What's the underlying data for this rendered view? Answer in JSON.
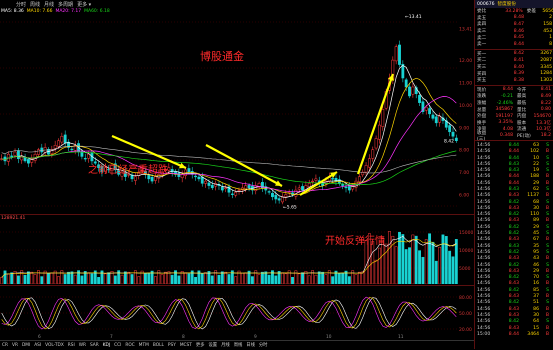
{
  "toolbar": {
    "items": [
      "分时",
      "周线",
      "月线",
      "多周期",
      "更多 ▾"
    ]
  },
  "ma_legend": [
    {
      "label": "MA5",
      "value": "8.36",
      "color": "#ffffff"
    },
    {
      "label": "MA10",
      "value": "7.66",
      "color": "#ffd700"
    },
    {
      "label": "MA20",
      "value": "7.17",
      "color": "#ff33ff"
    },
    {
      "label": "MA60",
      "value": "6.18",
      "color": "#19d319"
    }
  ],
  "price_axis": [
    "13.41",
    "12.00",
    "11.00",
    "10.00",
    "9.00",
    "8.00",
    "7.00",
    "6.00",
    "5.00"
  ],
  "price_markers": {
    "high": "13.41",
    "low": "5.65",
    "current_tag": "8.42"
  },
  "volume_label": "128921.41",
  "volume_axis": [
    "15000",
    "10000",
    "5000"
  ],
  "annotations": {
    "title": "博股通金",
    "note_down": "之前已经严重超跌",
    "note_up": "开始反弹行情"
  },
  "bottom_tabs": [
    "CR",
    "VR",
    "DMI",
    "ASI",
    "VOL-TDX",
    "RSI",
    "WR",
    "SAR",
    "KDJ",
    "CCI",
    "ROC",
    "MTM",
    "BOLL",
    "PSY",
    "MCST",
    "更多",
    "设置",
    "月线",
    "周线",
    "日线",
    "分时"
  ],
  "bottom_active": "KDJ",
  "x_ticks": [
    "6",
    "7",
    "8",
    "9",
    "10",
    "11"
  ],
  "stock": {
    "code": "000676",
    "name": "智度股份"
  },
  "orderbook_header": {
    "label": "委比",
    "value": "33.28%",
    "label2": "委差",
    "value2": "5656"
  },
  "asks": [
    {
      "label": "卖五",
      "price": "8.48",
      "vol": "2"
    },
    {
      "label": "卖四",
      "price": "8.47",
      "vol": "158"
    },
    {
      "label": "卖三",
      "price": "8.46",
      "vol": "453"
    },
    {
      "label": "卖二",
      "price": "8.45",
      "vol": "1"
    },
    {
      "label": "卖一",
      "price": "8.44",
      "vol": "8"
    }
  ],
  "bids": [
    {
      "label": "买一",
      "price": "8.42",
      "vol": "3267"
    },
    {
      "label": "买二",
      "price": "8.41",
      "vol": "2087"
    },
    {
      "label": "买三",
      "price": "8.40",
      "vol": "3345"
    },
    {
      "label": "买四",
      "price": "8.39",
      "vol": "1284"
    },
    {
      "label": "买五",
      "price": "8.38",
      "vol": "1303"
    }
  ],
  "stats": [
    {
      "k": "现价",
      "v": "8.44",
      "k2": "今开",
      "v2": "8.41"
    },
    {
      "k": "涨跌",
      "v": "-0.21",
      "k2": "最高",
      "v2": "8.49"
    },
    {
      "k": "涨幅",
      "v": "-2.46%",
      "k2": "最低",
      "v2": "8.22"
    },
    {
      "k": "总量",
      "v": "345867",
      "k2": "量比",
      "v2": "0.80"
    },
    {
      "k": "外盘",
      "v": "191197",
      "k2": "内盘",
      "v2": "154670"
    },
    {
      "k": "换手",
      "v": "3.35%",
      "k2": "股本",
      "v2": "13.3亿"
    },
    {
      "k": "净资",
      "v": "4.08",
      "k2": "流通",
      "v2": "10.3亿"
    },
    {
      "k": "收益(三)",
      "v": "0.348",
      "k2": "PE(动)",
      "v2": "18.2"
    }
  ],
  "ticks": [
    {
      "t": "14:56",
      "p": "8.44",
      "v": "63",
      "d": "S"
    },
    {
      "t": "14:56",
      "p": "8.44",
      "v": "102",
      "d": "B"
    },
    {
      "t": "14:56",
      "p": "8.44",
      "v": "10",
      "d": "S"
    },
    {
      "t": "14:56",
      "p": "8.43",
      "v": "22",
      "d": "S"
    },
    {
      "t": "14:56",
      "p": "8.43",
      "v": "19",
      "d": "S"
    },
    {
      "t": "14:56",
      "p": "8.44",
      "v": "188",
      "d": "B"
    },
    {
      "t": "14:56",
      "p": "8.44",
      "v": "29",
      "d": "B"
    },
    {
      "t": "14:56",
      "p": "8.43",
      "v": "62",
      "d": "S"
    },
    {
      "t": "14:56",
      "p": "8.43",
      "v": "1137",
      "d": "B"
    },
    {
      "t": "14:56",
      "p": "8.42",
      "v": "68",
      "d": "S"
    },
    {
      "t": "14:56",
      "p": "8.43",
      "v": "30",
      "d": "B"
    },
    {
      "t": "14:56",
      "p": "8.42",
      "v": "110",
      "d": "S"
    },
    {
      "t": "14:56",
      "p": "8.43",
      "v": "89",
      "d": "B"
    },
    {
      "t": "14:56",
      "p": "8.42",
      "v": "29",
      "d": "S"
    },
    {
      "t": "14:56",
      "p": "8.42",
      "v": "45",
      "d": "S"
    },
    {
      "t": "14:56",
      "p": "8.43",
      "v": "67",
      "d": "B"
    },
    {
      "t": "14:56",
      "p": "8.43",
      "v": "35",
      "d": "S"
    },
    {
      "t": "14:56",
      "p": "8.42",
      "v": "95",
      "d": "S"
    },
    {
      "t": "14:56",
      "p": "8.43",
      "v": "43",
      "d": "B"
    },
    {
      "t": "14:56",
      "p": "8.42",
      "v": "46",
      "d": "S"
    },
    {
      "t": "14:56",
      "p": "8.43",
      "v": "29",
      "d": "B"
    },
    {
      "t": "14:56",
      "p": "8.42",
      "v": "70",
      "d": "S"
    },
    {
      "t": "14:56",
      "p": "8.43",
      "v": "16",
      "d": "B"
    },
    {
      "t": "14:56",
      "p": "8.42",
      "v": "85",
      "d": "S"
    },
    {
      "t": "14:56",
      "p": "8.43",
      "v": "37",
      "d": "B"
    },
    {
      "t": "14:56",
      "p": "8.42",
      "v": "51",
      "d": "S"
    },
    {
      "t": "14:56",
      "p": "8.43",
      "v": "86",
      "d": "B"
    },
    {
      "t": "14:56",
      "p": "8.43",
      "v": "30",
      "d": "B"
    },
    {
      "t": "14:56",
      "p": "8.42",
      "v": "64",
      "d": "S"
    },
    {
      "t": "14:56",
      "p": "8.43",
      "v": "15",
      "d": "B"
    },
    {
      "t": "15:00",
      "p": "8.44",
      "v": "3464",
      "d": "B"
    }
  ],
  "colors": {
    "up": "#ff3b3b",
    "down": "#19d319",
    "ma5": "#ffffff",
    "ma10": "#ffd700",
    "ma20": "#ff33ff",
    "ma60": "#19d319",
    "arrow": "#ffff00"
  }
}
